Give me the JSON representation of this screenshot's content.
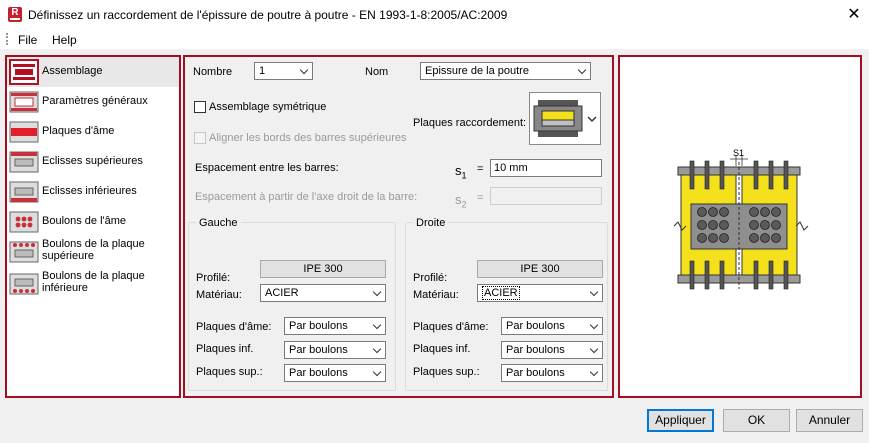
{
  "window": {
    "title": "Définissez un raccordement de l'épissure de poutre à poutre - EN 1993-1-8:2005/AC:2009",
    "app_icon_letter": "R",
    "close_glyph": "✕"
  },
  "menu": {
    "file": "File",
    "help": "Help"
  },
  "nav": {
    "items": [
      {
        "label": "Assemblage",
        "selected": true
      },
      {
        "label": "Paramètres généraux"
      },
      {
        "label": "Plaques d'âme"
      },
      {
        "label": "Eclisses supérieures"
      },
      {
        "label": "Eclisses inférieures"
      },
      {
        "label": "Boulons de l'âme"
      },
      {
        "label": "Boulons de la plaque supérieure"
      },
      {
        "label": "Boulons de la plaque inférieure"
      }
    ]
  },
  "form": {
    "nombre_label": "Nombre",
    "nombre_value": "1",
    "nom_label": "Nom",
    "nom_value": "Epissure de la poutre",
    "symmetric_label": "Assemblage symétrique",
    "symmetric_checked": false,
    "align_label": "Aligner les bords des barres supérieures",
    "align_checked": false,
    "plates_label": "Plaques raccordement:",
    "spacing_label": "Espacement entre les barres:",
    "s1_symbol": "s",
    "s1_sub": "1",
    "s1_eq": "=",
    "s1_value": "10 mm",
    "spacing_axis_label": "Espacement à partir de l'axe droit de la barre:",
    "s2_symbol": "s",
    "s2_sub": "2",
    "s2_eq": "=",
    "s2_value": ""
  },
  "left": {
    "title": "Gauche",
    "profile_label": "Profilé:",
    "profile_value": "IPE 300",
    "material_label": "Matériau:",
    "material_value": "ACIER",
    "web_label": "Plaques d'âme:",
    "web_value": "Par boulons",
    "lower_label": "Plaques inf.",
    "lower_value": "Par boulons",
    "upper_label": "Plaques sup.:",
    "upper_value": "Par boulons"
  },
  "right": {
    "title": "Droite",
    "profile_label": "Profilé:",
    "profile_value": "IPE 300",
    "material_label": "Matériau:",
    "material_value": "ACIER",
    "web_label": "Plaques d'âme:",
    "web_value": "Par boulons",
    "lower_label": "Plaques inf.",
    "lower_value": "Par boulons",
    "upper_label": "Plaques sup.:",
    "upper_value": "Par boulons"
  },
  "preview": {
    "s1_label": "S1"
  },
  "buttons": {
    "apply": "Appliquer",
    "ok": "OK",
    "cancel": "Annuler"
  },
  "colors": {
    "accent_frame": "#a30f22",
    "beam_yellow": "#f5e11b",
    "plate_gray": "#9a9a9a",
    "focus_blue": "#0078d7"
  }
}
